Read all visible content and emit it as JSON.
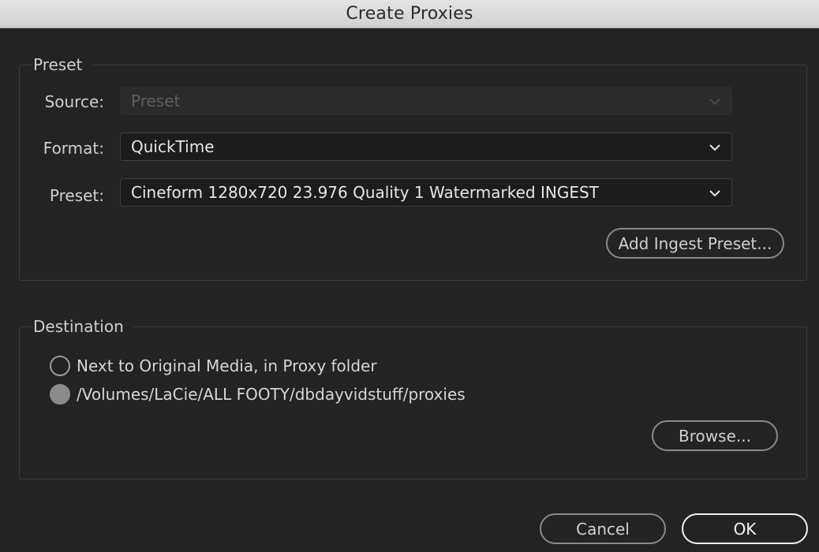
{
  "window": {
    "title": "Create Proxies"
  },
  "preset_group": {
    "legend": "Preset",
    "source": {
      "label": "Source:",
      "value": "Preset"
    },
    "format": {
      "label": "Format:",
      "value": "QuickTime"
    },
    "preset": {
      "label": "Preset:",
      "value": "Cineform 1280x720 23.976 Quality 1 Watermarked INGEST"
    },
    "add_ingest_label": "Add Ingest Preset..."
  },
  "destination_group": {
    "legend": "Destination",
    "options": [
      {
        "label": "Next to Original Media, in Proxy folder",
        "selected": false
      },
      {
        "label": "/Volumes/LaCie/ALL FOOTY/dbdayvidstuff/proxies",
        "selected": true
      }
    ],
    "browse_label": "Browse..."
  },
  "footer": {
    "cancel_label": "Cancel",
    "ok_label": "OK"
  }
}
